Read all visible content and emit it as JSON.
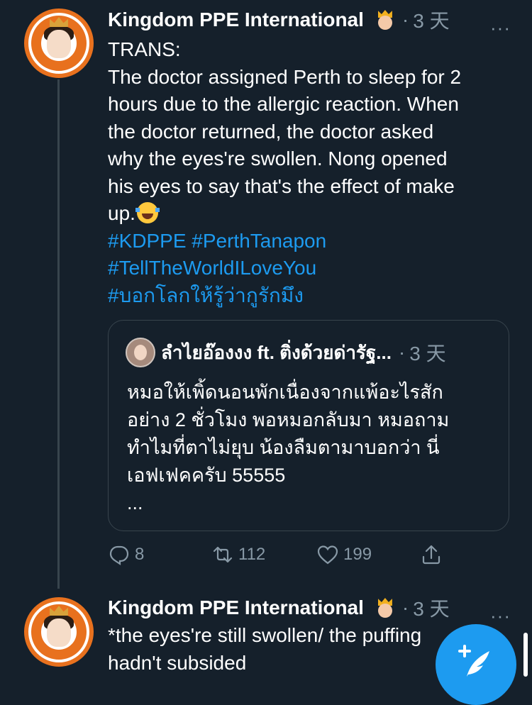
{
  "tweet1": {
    "display_name": "Kingdom PPE International",
    "badge_icon": "crown-emoji-icon",
    "separator": "·",
    "time": "3 天",
    "more": "···",
    "lines": [
      "TRANS:",
      "The doctor assigned Perth to sleep for 2",
      "hours due to the allergic reaction. When",
      "the doctor returned, the doctor asked",
      "why the eyes're swollen. Nong opened",
      "his eyes to say that's the effect of make",
      "up."
    ],
    "emoji": "laughing-tears-emoji-icon",
    "hashtags": [
      "#KDPPE #PerthTanapon",
      "#TellTheWorldILoveYou",
      "#บอกโลกให้รู้ว่ากูรักมึง"
    ],
    "quote": {
      "display_name": "ลำไยอ๊องงง ft. ติ่งด้วยด่ารัฐ...",
      "separator": "·",
      "time": "3 天",
      "lines": [
        "หมอให้เพิ้ดนอนพักเนื่องจากแพ้อะไรสัก",
        "อย่าง 2 ชั่วโมง พอหมอกลับมา หมอถาม",
        "ทำไมที่ตาไม่ยุบ น้องลืมตามาบอกว่า นี่",
        "เอฟเฟคครับ 55555",
        "..."
      ]
    },
    "actions": {
      "replies": "8",
      "retweets": "112",
      "likes": "199"
    }
  },
  "tweet2": {
    "display_name": "Kingdom PPE International",
    "separator": "·",
    "time": "3 天",
    "more": "···",
    "lines": [
      "*the eyes're still swollen/ the puffing",
      "hadn't subsided"
    ]
  },
  "fab": {
    "icon": "compose-tweet-icon"
  },
  "colors": {
    "background": "#15202b",
    "accent": "#1d9bf0",
    "muted": "#8899a6",
    "border": "#38444d"
  }
}
